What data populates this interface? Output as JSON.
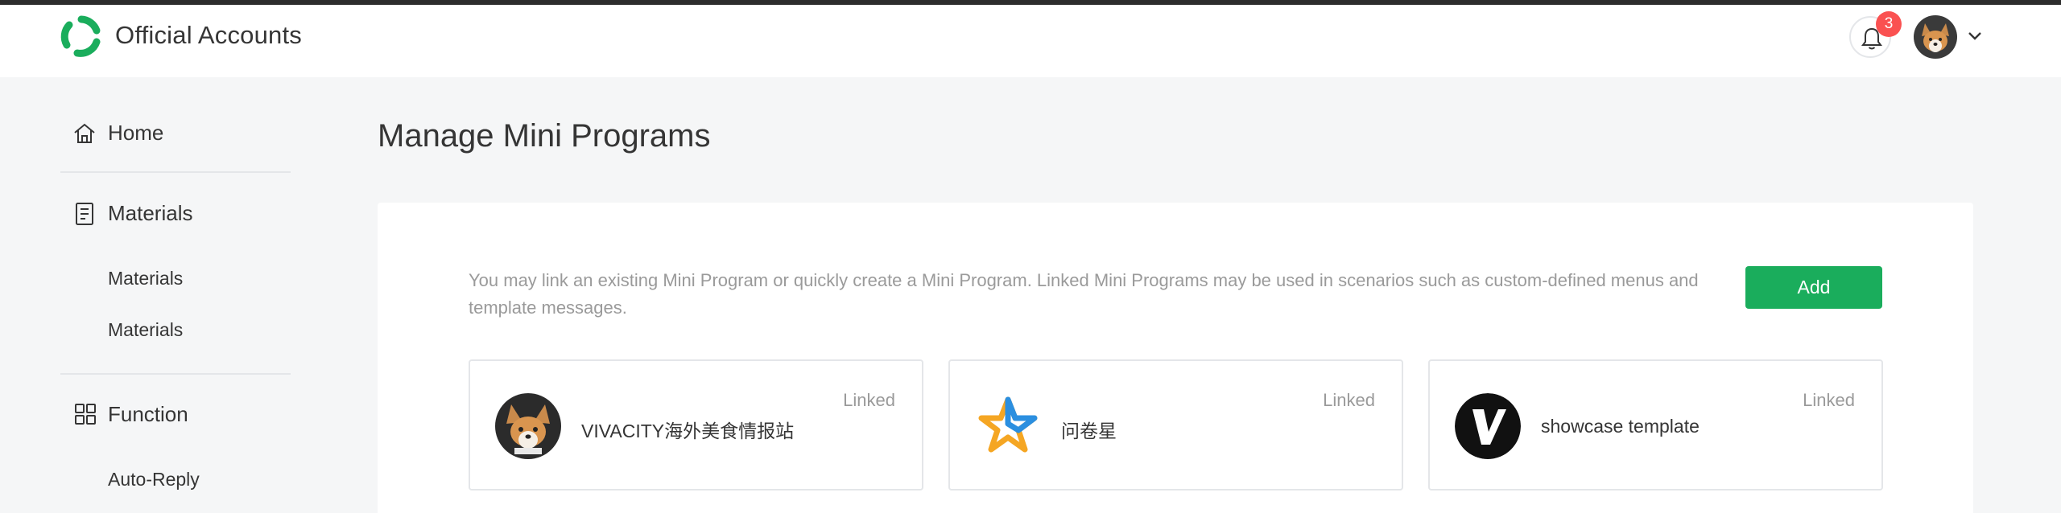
{
  "header": {
    "brand": "Official Accounts",
    "notification_count": "3"
  },
  "sidebar": {
    "items": [
      {
        "label": "Home",
        "icon": "home-icon"
      },
      {
        "label": "Materials",
        "icon": "document-icon",
        "children": [
          "Materials",
          "Materials"
        ]
      },
      {
        "label": "Function",
        "icon": "grid-icon",
        "children": [
          "Auto-Reply"
        ]
      }
    ]
  },
  "main": {
    "title": "Manage Mini Programs",
    "description": "You may link an existing Mini Program or quickly create a Mini Program. Linked Mini Programs may be used in scenarios such as custom-defined menus and template messages.",
    "add_label": "Add",
    "mini_programs": [
      {
        "name": "VIVACITY海外美食情报站",
        "status": "Linked",
        "icon": "corgi-avatar-icon"
      },
      {
        "name": "问卷星",
        "status": "Linked",
        "icon": "star-logo-icon"
      },
      {
        "name": "showcase template",
        "status": "Linked",
        "icon": "v-logo-icon"
      }
    ]
  },
  "colors": {
    "accent": "#1aad5c",
    "badge": "#fa5151",
    "background": "#f5f6f7"
  }
}
